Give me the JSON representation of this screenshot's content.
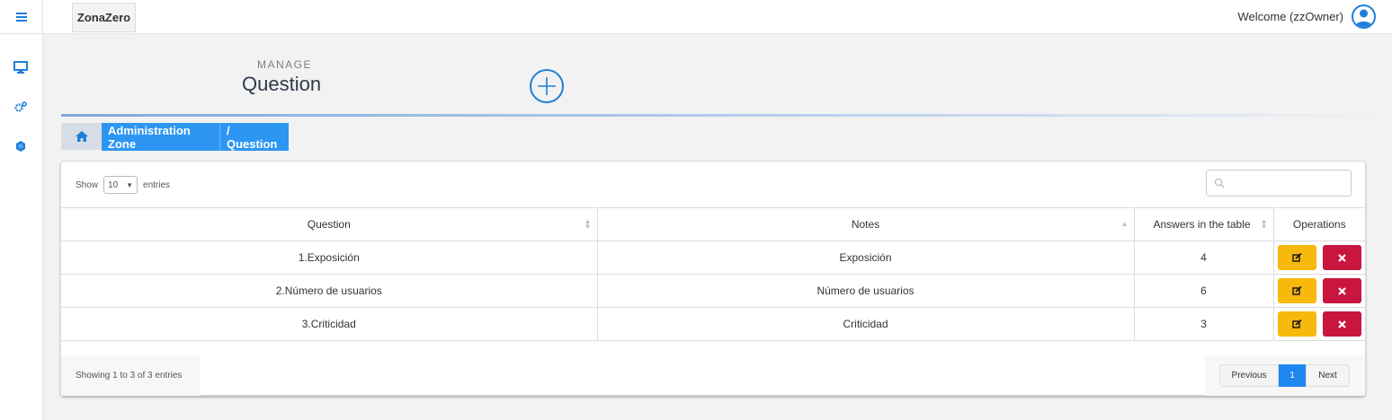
{
  "app": {
    "brand": "ZonaZero",
    "welcome": "Welcome (zzOwner)"
  },
  "sidebar": {
    "icons": [
      "hamburger-menu-icon",
      "monitor-icon",
      "gears-icon",
      "shield-icon"
    ]
  },
  "header": {
    "manage_label": "MANAGE",
    "title": "Question"
  },
  "breadcrumb": {
    "items": [
      "Administration Zone",
      "/ Question"
    ]
  },
  "table_controls": {
    "show_label": "Show",
    "page_length": "10",
    "entries_label": "entries",
    "search_placeholder": ""
  },
  "table": {
    "columns": [
      "Question",
      "Notes",
      "Answers in the table",
      "Operations"
    ],
    "rows": [
      {
        "question": "1.Exposición",
        "notes": "Exposición",
        "answers": "4"
      },
      {
        "question": "2.Número de usuarios",
        "notes": "Número de usuarios",
        "answers": "6"
      },
      {
        "question": "3.Criticidad",
        "notes": "Criticidad",
        "answers": "3"
      }
    ]
  },
  "footer": {
    "info": "Showing 1 to 3 of 3 entries",
    "previous": "Previous",
    "current_page": "1",
    "next": "Next"
  },
  "colors": {
    "primary": "#2d96f3",
    "edit": "#f7b90b",
    "delete": "#c8163f"
  }
}
